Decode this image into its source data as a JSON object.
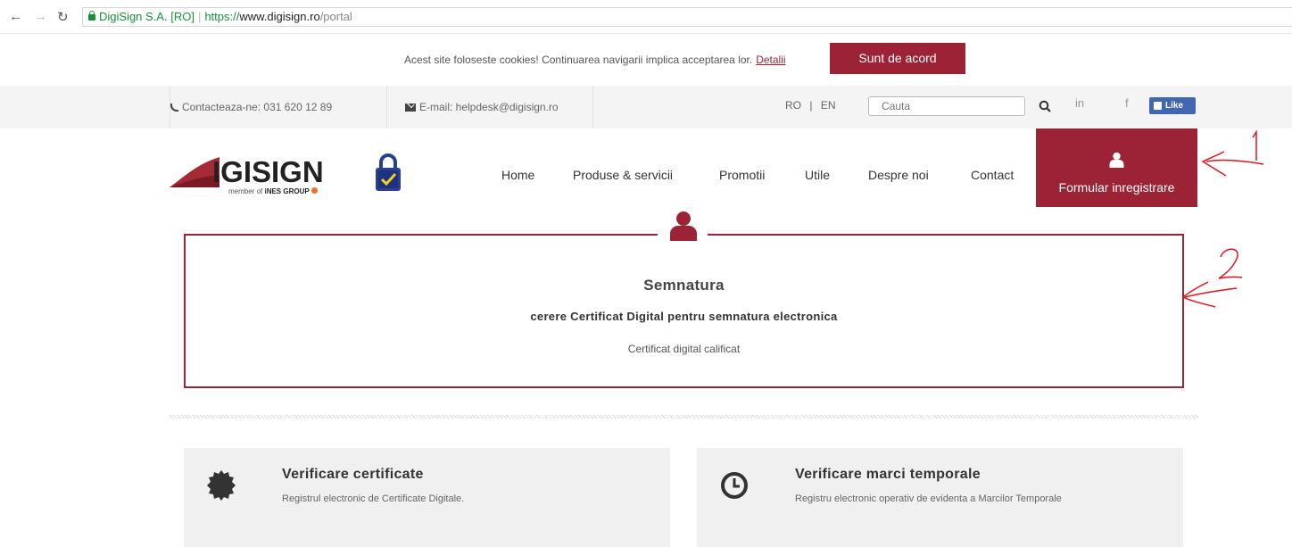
{
  "browser": {
    "site_owner": "DigiSign S.A. [RO]",
    "url_proto": "https://",
    "url_domain": "www.digisign.ro",
    "url_path": "/portal"
  },
  "cookie": {
    "text": "Acest site foloseste cookies! Continuarea navigarii implica acceptarea lor.",
    "link": "Detalii",
    "button": "Sunt de acord"
  },
  "topbar": {
    "phone": "Contacteaza-ne: 031 620 12 89",
    "email": "E-mail: helpdesk@digisign.ro",
    "lang_ro": "RO",
    "lang_sep": "|",
    "lang_en": "EN",
    "search_placeholder": "Cauta",
    "social_linkedin": "in",
    "social_facebook": "f",
    "like_label": "Like"
  },
  "logo": {
    "text": "IGISIGN",
    "sub_prefix": "member of ",
    "sub_group": "iNES GROUP"
  },
  "nav": {
    "items": [
      "Home",
      "Produse & servicii",
      "Promotii",
      "Utile",
      "Despre noi",
      "Contact"
    ],
    "register": "Formular inregistrare"
  },
  "annotations": [
    "1",
    "2"
  ],
  "semnatura": {
    "title": "Semnatura",
    "subtitle": "cerere Certificat Digital pentru semnatura electronica",
    "description": "Certificat digital calificat"
  },
  "cards": [
    {
      "title": "Verificare certificate",
      "text": "Registrul electronic de Certificate Digitale.",
      "icon": "certificate-icon"
    },
    {
      "title": "Verificare marci temporale",
      "text": "Registru electronic operativ de evidenta a Marcilor Temporale",
      "icon": "clock-icon"
    }
  ],
  "colors": {
    "brand": "#9b2335",
    "annotation": "#e0141e"
  }
}
